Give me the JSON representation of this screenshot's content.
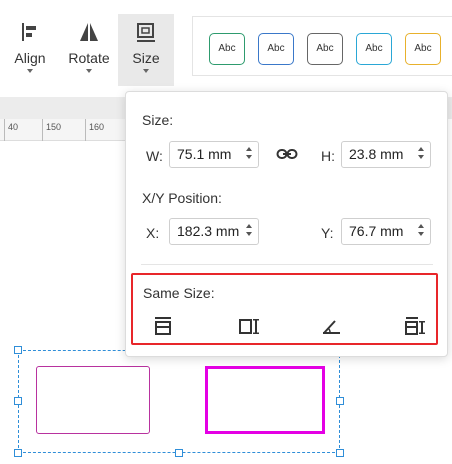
{
  "toolbar": {
    "align": {
      "label": "Align",
      "icon": "align-left-icon"
    },
    "rotate": {
      "label": "Rotate",
      "icon": "flip-icon"
    },
    "size": {
      "label": "Size",
      "icon": "size-icon"
    }
  },
  "styles": [
    {
      "label": "Abc",
      "color": "#2e9b6e"
    },
    {
      "label": "Abc",
      "color": "#3a78c9"
    },
    {
      "label": "Abc",
      "color": "#666666"
    },
    {
      "label": "Abc",
      "color": "#2aa7d6"
    },
    {
      "label": "Abc",
      "color": "#e8b12c"
    }
  ],
  "ruler": {
    "ticks": [
      "40",
      "150",
      "160"
    ]
  },
  "size_panel": {
    "size_label": "Size:",
    "width_label": "W:",
    "width_value": "75.1 mm",
    "height_label": "H:",
    "height_value": "23.8 mm",
    "lock_icon": "link-icon",
    "position_label": "X/Y Position:",
    "x_label": "X:",
    "x_value": "182.3 mm",
    "y_label": "Y:",
    "y_value": "76.7 mm",
    "same_size_label": "Same Size:",
    "same_size_icons": [
      "same-width-icon",
      "same-height-icon",
      "same-angle-icon",
      "same-size-icon"
    ]
  },
  "colors": {
    "accent": "#2f8ed8",
    "highlight": "#e8262a",
    "shape1": "#b8329f",
    "shape2": "#e400e4"
  }
}
